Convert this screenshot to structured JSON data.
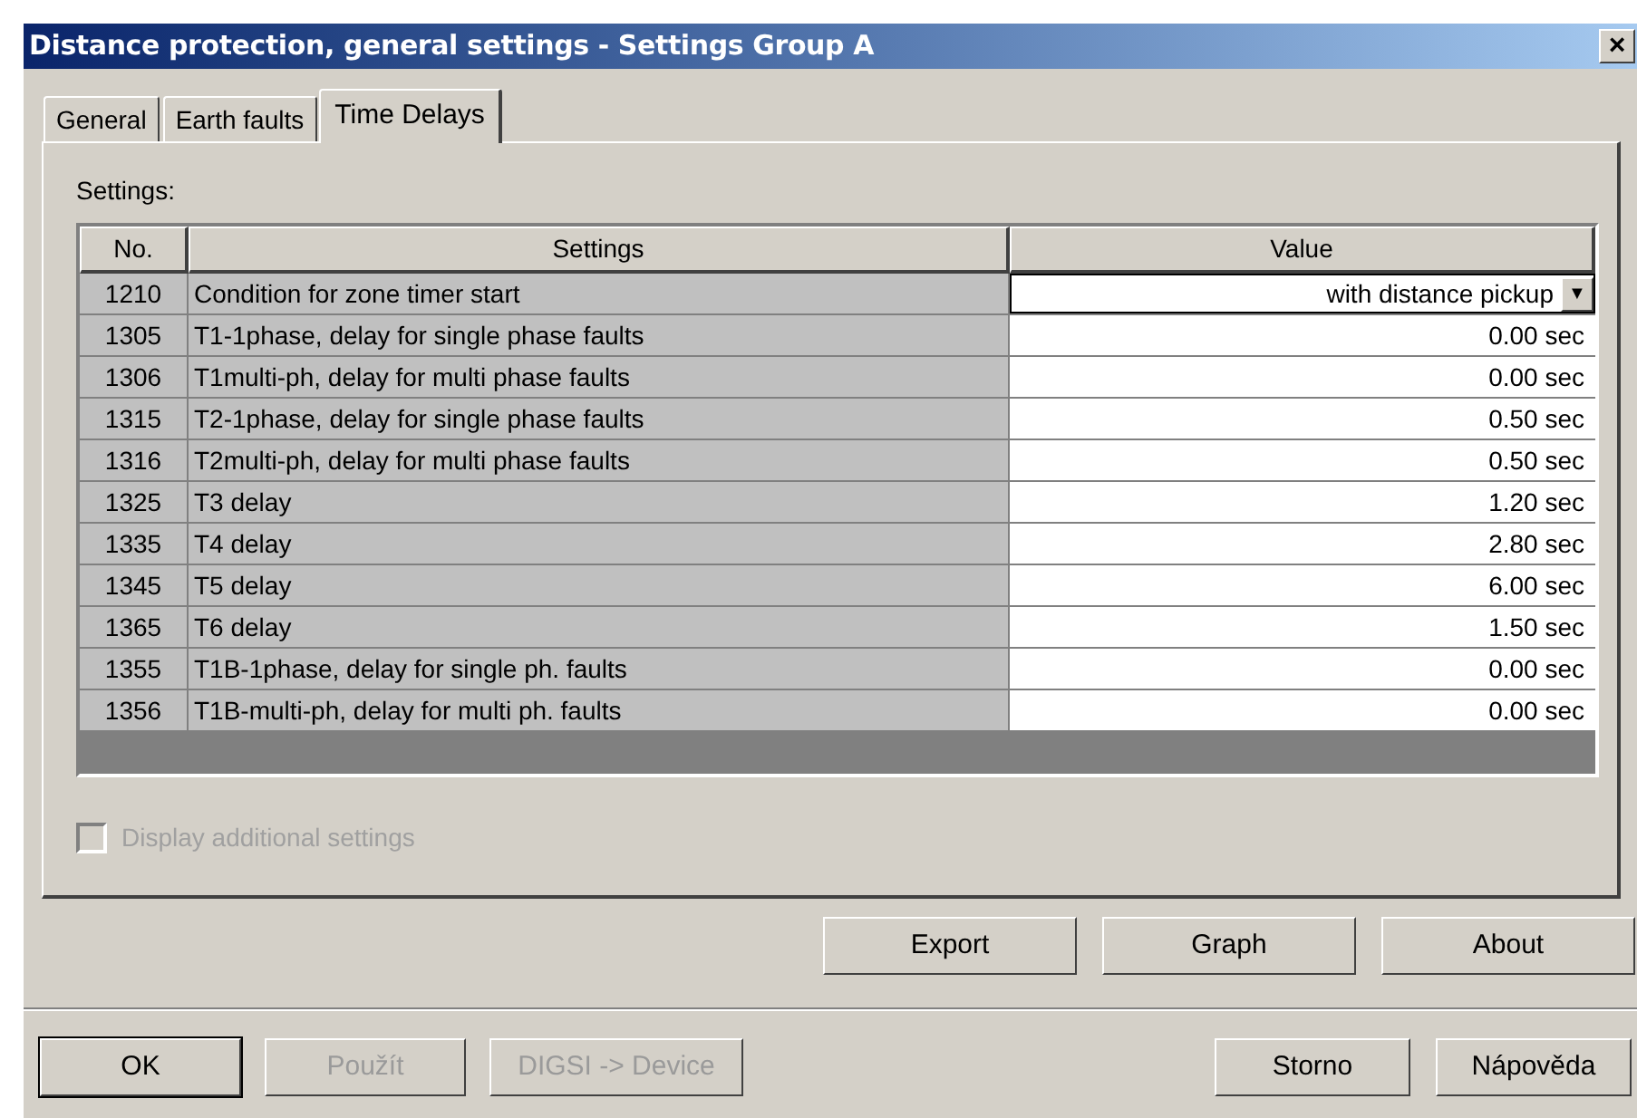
{
  "window": {
    "title": "Distance protection, general settings - Settings Group A",
    "close": "×"
  },
  "tabs": [
    {
      "label": "General",
      "selected": false
    },
    {
      "label": "Earth faults",
      "selected": false
    },
    {
      "label": "Time Delays",
      "selected": true
    }
  ],
  "settings_label": "Settings:",
  "table": {
    "columns": [
      "No.",
      "Settings",
      "Value"
    ],
    "rows": [
      {
        "no": "1210",
        "setting": "Condition for zone timer start",
        "value": "with distance pickup",
        "kind": "dropdown",
        "caret": "▼"
      },
      {
        "no": "1305",
        "setting": "T1-1phase, delay for single phase faults",
        "value": "0.00 sec",
        "kind": "text"
      },
      {
        "no": "1306",
        "setting": "T1multi-ph, delay for multi phase faults",
        "value": "0.00 sec",
        "kind": "text"
      },
      {
        "no": "1315",
        "setting": "T2-1phase, delay for single phase faults",
        "value": "0.50 sec",
        "kind": "text"
      },
      {
        "no": "1316",
        "setting": "T2multi-ph, delay for multi phase faults",
        "value": "0.50 sec",
        "kind": "text"
      },
      {
        "no": "1325",
        "setting": "T3 delay",
        "value": "1.20 sec",
        "kind": "text"
      },
      {
        "no": "1335",
        "setting": "T4 delay",
        "value": "2.80 sec",
        "kind": "text"
      },
      {
        "no": "1345",
        "setting": "T5 delay",
        "value": "6.00 sec",
        "kind": "text"
      },
      {
        "no": "1365",
        "setting": "T6 delay",
        "value": "1.50 sec",
        "kind": "text"
      },
      {
        "no": "1355",
        "setting": "T1B-1phase, delay for single ph. faults",
        "value": "0.00 sec",
        "kind": "text"
      },
      {
        "no": "1356",
        "setting": "T1B-multi-ph, delay for multi ph. faults",
        "value": "0.00 sec",
        "kind": "text"
      }
    ]
  },
  "additional_settings": {
    "label": "Display additional settings",
    "checked": false,
    "disabled": true
  },
  "panel_buttons": [
    {
      "label": "Export",
      "disabled": false
    },
    {
      "label": "Graph",
      "disabled": false
    },
    {
      "label": "About",
      "disabled": false
    }
  ],
  "dialog_buttons_left": [
    {
      "label": "OK",
      "disabled": false,
      "default": true
    },
    {
      "label": "Použít",
      "disabled": true,
      "default": false
    },
    {
      "label": "DIGSI -> Device",
      "disabled": true,
      "default": false
    }
  ],
  "dialog_buttons_right": [
    {
      "label": "Storno",
      "disabled": false,
      "default": false
    },
    {
      "label": "Nápověda",
      "disabled": false,
      "default": false
    }
  ]
}
